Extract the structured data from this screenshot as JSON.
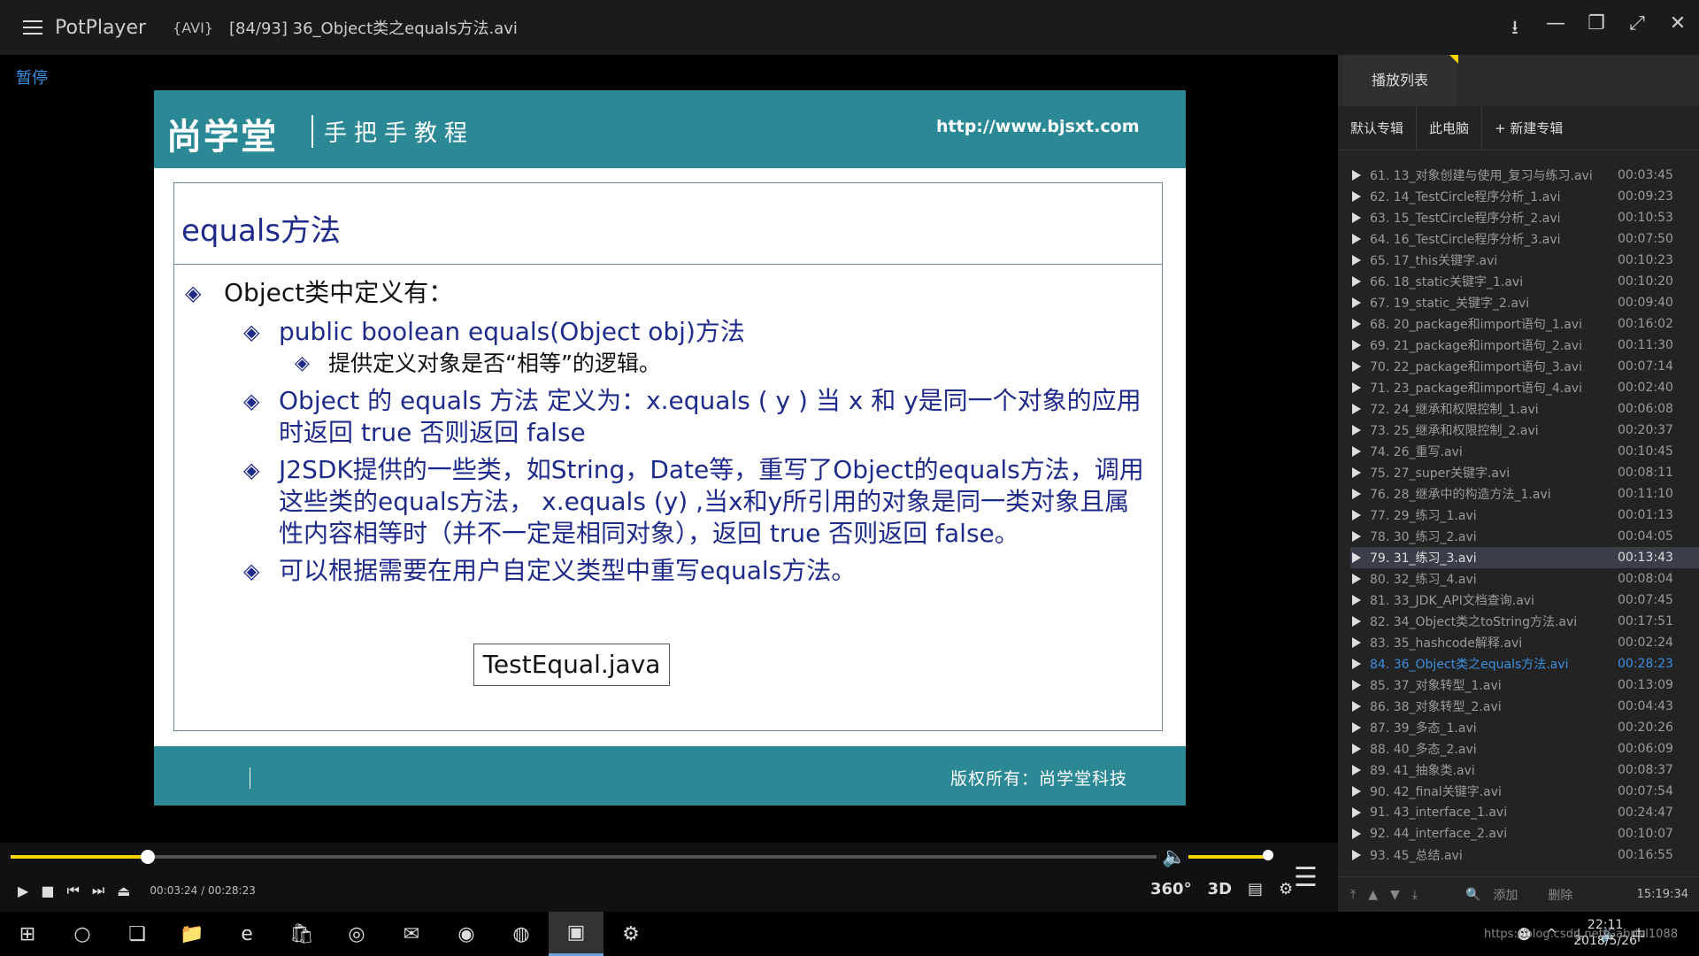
{
  "titlebar": {
    "app": "PotPlayer",
    "format": "{AVI}",
    "file": "[84/93] 36_Object类之equals方法.avi"
  },
  "video": {
    "status": "暂停",
    "slide": {
      "logo": "尚学堂",
      "tagline": "手把手教程",
      "url": "http://www.bjsxt.com",
      "title": "equals方法",
      "b1": "Object类中定义有：",
      "b2a": "public boolean equals(Object obj)方法",
      "b3a": "提供定义对象是否“相等”的逻辑。",
      "b2b": "Object 的 equals 方法 定义为：x.equals ( y ) 当 x 和 y是同一个对象的应用时返回 true 否则返回 false",
      "b2c": "J2SDK提供的一些类，如String，Date等，重写了Object的equals方法，调用这些类的equals方法， x.equals (y) ,当x和y所引用的对象是同一类对象且属性内容相等时（并不一定是相同对象），返回 true 否则返回 false。",
      "b2d": "可以根据需要在用户自定义类型中重写equals方法。",
      "java_file": "TestEqual.java",
      "copyright": "版权所有：尚学堂科技"
    }
  },
  "controls": {
    "current_time": "00:03:24",
    "total_time": "00:28:23",
    "progress": 0.12,
    "volume": 1.0,
    "btn_360": "360°",
    "btn_3d": "3D"
  },
  "playlist": {
    "tab": "播放列表",
    "sub_default": "默认专辑",
    "sub_pc": "此电脑",
    "sub_new": "+ 新建专辑",
    "items": [
      {
        "name": "61. 13_对象创建与使用_复习与练习.avi",
        "dur": "00:03:45"
      },
      {
        "name": "62. 14_TestCircle程序分析_1.avi",
        "dur": "00:09:23"
      },
      {
        "name": "63. 15_TestCircle程序分析_2.avi",
        "dur": "00:10:53"
      },
      {
        "name": "64. 16_TestCircle程序分析_3.avi",
        "dur": "00:07:50"
      },
      {
        "name": "65. 17_this关键字.avi",
        "dur": "00:10:23"
      },
      {
        "name": "66. 18_static关键字_1.avi",
        "dur": "00:10:20"
      },
      {
        "name": "67. 19_static_关键字_2.avi",
        "dur": "00:09:40"
      },
      {
        "name": "68. 20_package和import语句_1.avi",
        "dur": "00:16:02"
      },
      {
        "name": "69. 21_package和import语句_2.avi",
        "dur": "00:11:30"
      },
      {
        "name": "70. 22_package和import语句_3.avi",
        "dur": "00:07:14"
      },
      {
        "name": "71. 23_package和import语句_4.avi",
        "dur": "00:02:40"
      },
      {
        "name": "72. 24_继承和权限控制_1.avi",
        "dur": "00:06:08"
      },
      {
        "name": "73. 25_继承和权限控制_2.avi",
        "dur": "00:20:37"
      },
      {
        "name": "74. 26_重写.avi",
        "dur": "00:10:45"
      },
      {
        "name": "75. 27_super关键字.avi",
        "dur": "00:08:11"
      },
      {
        "name": "76. 28_继承中的构造方法_1.avi",
        "dur": "00:11:10"
      },
      {
        "name": "77. 29_练习_1.avi",
        "dur": "00:01:13"
      },
      {
        "name": "78. 30_练习_2.avi",
        "dur": "00:04:05"
      },
      {
        "name": "79. 31_练习_3.avi",
        "dur": "00:13:43"
      },
      {
        "name": "80. 32_练习_4.avi",
        "dur": "00:08:04"
      },
      {
        "name": "81. 33_JDK_API文档查询.avi",
        "dur": "00:07:45"
      },
      {
        "name": "82. 34_Object类之toString方法.avi",
        "dur": "00:17:51"
      },
      {
        "name": "83. 35_hashcode解释.avi",
        "dur": "00:02:24"
      },
      {
        "name": "84. 36_Object类之equals方法.avi",
        "dur": "00:28:23"
      },
      {
        "name": "85. 37_对象转型_1.avi",
        "dur": "00:13:09"
      },
      {
        "name": "86. 38_对象转型_2.avi",
        "dur": "00:04:43"
      },
      {
        "name": "87. 39_多态_1.avi",
        "dur": "00:20:26"
      },
      {
        "name": "88. 40_多态_2.avi",
        "dur": "00:06:09"
      },
      {
        "name": "89. 41_抽象类.avi",
        "dur": "00:08:37"
      },
      {
        "name": "90. 42_final关键字.avi",
        "dur": "00:07:54"
      },
      {
        "name": "91. 43_interface_1.avi",
        "dur": "00:24:47"
      },
      {
        "name": "92. 44_interface_2.avi",
        "dur": "00:10:07"
      },
      {
        "name": "93. 45_总结.avi",
        "dur": "00:16:55"
      }
    ],
    "selected_index": 18,
    "current_index": 23,
    "footer_add": "添加",
    "footer_delete": "删除",
    "footer_time": "15:19:34"
  },
  "taskbar": {
    "ime": "中",
    "time": "22:11",
    "date": "2018/5/26",
    "watermark": "https://blog.csdn.net/Gabriel1088"
  }
}
